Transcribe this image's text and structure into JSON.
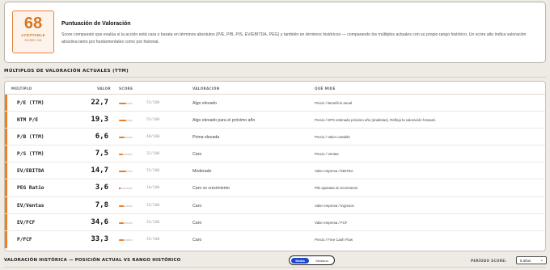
{
  "score_card": {
    "score": "68",
    "label": "ACEPTABLE",
    "sub": "SCORE / 100",
    "title": "Puntuación de Valoración",
    "description": "Score compuesto que evalúa si la acción está cara o barata en términos absolutos (P/E, P/B, P/S, EV/EBITDA, PEG) y también en términos históricos — comparando los múltiplos actuales con su propio rango histórico. Un score alto indica valoración atractiva tanto por fundamentales como por historial."
  },
  "section_title": "MÚLTIPLOS DE VALORACIÓN ACTUALES (TTM)",
  "table": {
    "headers": {
      "metric": "MÚLTIPLO",
      "value": "VALOR",
      "score": "SCORE",
      "valuation": "VALORACIÓN",
      "measures": "QUÉ MIDE"
    },
    "rows": [
      {
        "name": "P/E (TTM)",
        "value": "22,7",
        "score_text": "55/100",
        "score": 55,
        "bar_color": "#ef7d22",
        "valuation": "Algo elevado",
        "measures": "Precio / Beneficio anual"
      },
      {
        "name": "NTM P/E",
        "value": "19,3",
        "score_text": "55/100",
        "score": 55,
        "bar_color": "#ef7d22",
        "valuation": "Algo elevado para el próximo año",
        "measures": "Precio / EPS estimado próximo año (analistas). Refleja la valoración forward."
      },
      {
        "name": "P/B (TTM)",
        "value": "6,6",
        "score_text": "40/100",
        "score": 40,
        "bar_color": "#ef7d22",
        "valuation": "Prima elevada",
        "measures": "Precio / Valor contable"
      },
      {
        "name": "P/S (TTM)",
        "value": "7,5",
        "score_text": "32/100",
        "score": 32,
        "bar_color": "#ef7d22",
        "valuation": "Caro",
        "measures": "Precio / Ventas"
      },
      {
        "name": "EV/EBITDA",
        "value": "14,7",
        "score_text": "55/100",
        "score": 55,
        "bar_color": "#ef7d22",
        "valuation": "Moderado",
        "measures": "Valor empresa / EBITDA"
      },
      {
        "name": "PEG Ratio",
        "value": "3,6",
        "score_text": "10/100",
        "score": 10,
        "bar_color": "#e0303a",
        "valuation": "Caro vs crecimiento",
        "measures": "P/E ajustado al crecimiento"
      },
      {
        "name": "EV/Ventas",
        "value": "7,8",
        "score_text": "35/100",
        "score": 35,
        "bar_color": "#ef7d22",
        "valuation": "Caro",
        "measures": "Valor empresa / Ingresos"
      },
      {
        "name": "EV/FCF",
        "value": "34,6",
        "score_text": "35/100",
        "score": 35,
        "bar_color": "#ef7d22",
        "valuation": "Caro",
        "measures": "Valor empresa / FCF"
      },
      {
        "name": "P/FCF",
        "value": "33,3",
        "score_text": "35/100",
        "score": 35,
        "bar_color": "#ef7d22",
        "valuation": "Caro",
        "measures": "Precio / Free Cash Flow"
      }
    ]
  },
  "footer": {
    "title": "VALORACIÓN HISTÓRICA — POSICIÓN ACTUAL VS RANGO HISTÓRICO",
    "toggle": {
      "active": "Media",
      "inactive": "Mediana"
    },
    "period_label": "PERÍODO SCORE:",
    "period_value": "5 años"
  }
}
